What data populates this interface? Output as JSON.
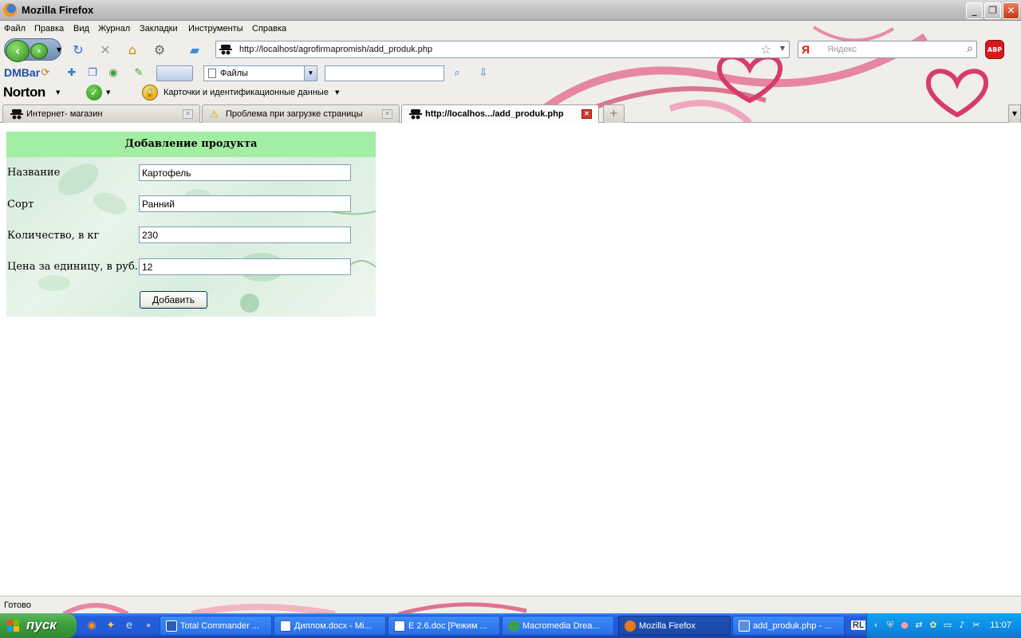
{
  "window": {
    "title": "Mozilla Firefox",
    "controls": {
      "minimize": "_",
      "maximize": "❐",
      "close": "✕"
    }
  },
  "menu": {
    "items": [
      "Файл",
      "Правка",
      "Вид",
      "Журнал",
      "Закладки",
      "Инструменты",
      "Справка"
    ]
  },
  "navbar": {
    "url": "http://localhost/agrofirmapromish/add_produk.php",
    "search_placeholder": "Яндекс",
    "search_engine_label": "Я",
    "adblock_label": "ABP"
  },
  "toolbar2": {
    "dmbar_label": "DMBar",
    "files_select_value": "Файлы",
    "search_field_value": ""
  },
  "toolbar3": {
    "norton_label": "Norton",
    "cards_label": "Карточки и идентификационные данные"
  },
  "tabs": [
    {
      "label": "Интернет- магазин",
      "icon": "spy-icon",
      "active": false
    },
    {
      "label": "Проблема при загрузке страницы",
      "icon": "warning-icon",
      "active": false
    },
    {
      "label": "http://localhos.../add_produk.php",
      "icon": "spy-icon",
      "active": true
    }
  ],
  "form": {
    "heading": "Добавление продукта",
    "fields": [
      {
        "label": "Название",
        "value": "Картофель"
      },
      {
        "label": "Сорт",
        "value": "Ранний"
      },
      {
        "label": "Количество, в кг",
        "value": "230"
      },
      {
        "label": "Цена за единицу, в руб.",
        "value": "12"
      }
    ],
    "submit_label": "Добавить"
  },
  "status": {
    "text": "Готово"
  },
  "taskbar": {
    "start_label": "пуск",
    "buttons": [
      {
        "label": "Total Commander ...",
        "icon_color": "#2b5db8",
        "active": false
      },
      {
        "label": "Диплом.docx - Mi...",
        "icon_color": "#2b5db8",
        "active": false
      },
      {
        "label": "E 2.6.doc [Режим ...",
        "icon_color": "#2b5db8",
        "active": false
      },
      {
        "label": "Macromedia Drea...",
        "icon_color": "#3aa14a",
        "active": false
      },
      {
        "label": "Mozilla Firefox",
        "icon_color": "#e6791b",
        "active": true
      },
      {
        "label": "add_produk.php - ...",
        "icon_color": "#5a8fd6",
        "active": false
      }
    ],
    "lang": "RL",
    "clock": "11:07"
  },
  "colors": {
    "form_header_bg": "#a3eda4",
    "accent_heart": "#d63c6a"
  }
}
